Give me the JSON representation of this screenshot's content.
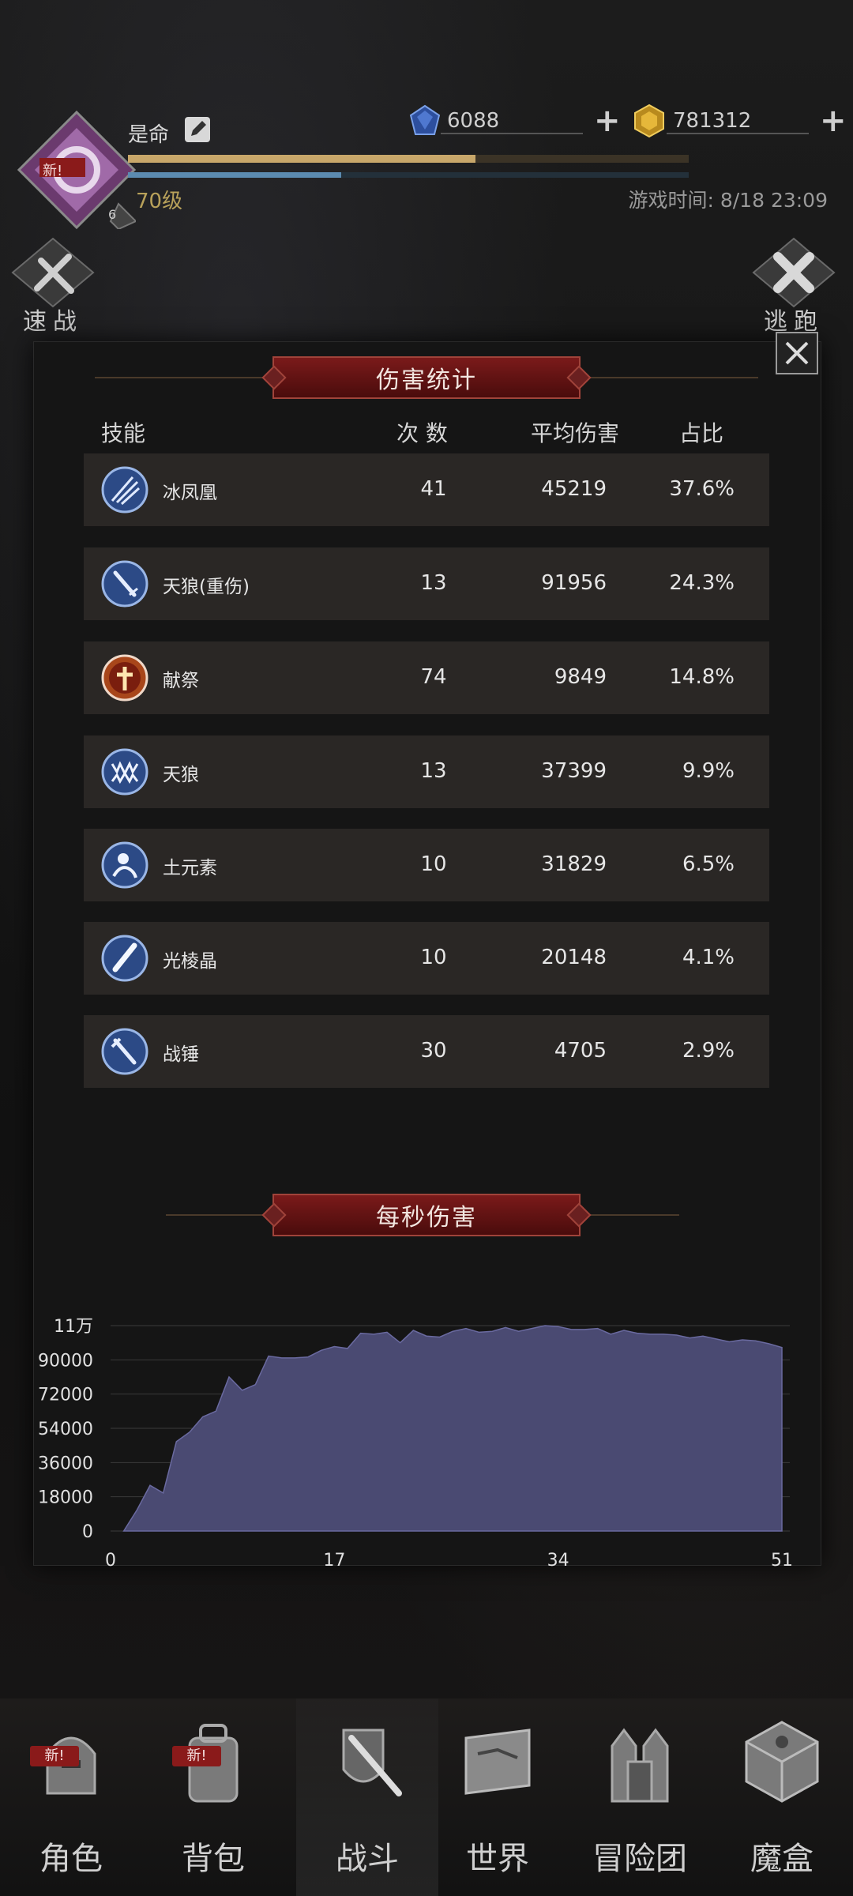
{
  "header": {
    "player_name": "是命",
    "avatar_badge": "新!",
    "level_small": "6",
    "level": "70级",
    "xp_fraction": 0.62,
    "hp_fraction": 0.38,
    "gems": "6088",
    "gold": "781312",
    "game_time": "游戏时间: 8/18 23:09",
    "quick_battle": "速战",
    "escape": "逃跑"
  },
  "damage_stats": {
    "title": "伤害统计",
    "columns": {
      "skill": "技能",
      "count": "次 数",
      "avg": "平均伤害",
      "share": "占比"
    },
    "rows": [
      {
        "icon": "ice-phoenix-icon",
        "name": "冰凤凰",
        "count": "41",
        "avg": "45219",
        "share": "37.6%"
      },
      {
        "icon": "sword-icon",
        "name": "天狼(重伤)",
        "count": "13",
        "avg": "91956",
        "share": "24.3%"
      },
      {
        "icon": "sacrifice-icon",
        "name": "献祭",
        "count": "74",
        "avg": "9849",
        "share": "14.8%"
      },
      {
        "icon": "wolf-fang-icon",
        "name": "天狼",
        "count": "13",
        "avg": "37399",
        "share": "9.9%"
      },
      {
        "icon": "earth-elemental-icon",
        "name": "土元素",
        "count": "10",
        "avg": "31829",
        "share": "6.5%"
      },
      {
        "icon": "crystal-blade-icon",
        "name": "光棱晶",
        "count": "10",
        "avg": "20148",
        "share": "4.1%"
      },
      {
        "icon": "warhammer-icon",
        "name": "战锤",
        "count": "30",
        "avg": "4705",
        "share": "2.9%"
      }
    ]
  },
  "dps": {
    "title": "每秒伤害"
  },
  "chart_data": {
    "type": "area",
    "title": "每秒伤害",
    "xlabel": "",
    "ylabel": "",
    "x_ticks": [
      "0",
      "17",
      "34",
      "51"
    ],
    "y_ticks": [
      "0",
      "18000",
      "36000",
      "54000",
      "72000",
      "90000",
      "11万"
    ],
    "xlim": [
      0,
      51
    ],
    "ylim": [
      0,
      108000
    ],
    "grid": true,
    "color": "#4a4a72",
    "x": [
      1,
      2,
      3,
      4,
      5,
      6,
      7,
      8,
      9,
      10,
      11,
      12,
      13,
      14,
      15,
      16,
      17,
      18,
      19,
      20,
      21,
      22,
      23,
      24,
      25,
      26,
      27,
      28,
      29,
      30,
      31,
      32,
      33,
      34,
      35,
      36,
      37,
      38,
      39,
      40,
      41,
      42,
      43,
      44,
      45,
      46,
      47,
      48,
      49,
      50,
      51
    ],
    "values": [
      0,
      11000,
      24000,
      20000,
      47000,
      52000,
      60000,
      63000,
      81000,
      74000,
      77000,
      92000,
      91000,
      91000,
      91500,
      95000,
      97000,
      96000,
      104000,
      103500,
      104500,
      99000,
      105500,
      102500,
      102000,
      105000,
      106500,
      104500,
      105000,
      107000,
      105000,
      106500,
      108000,
      107500,
      106000,
      106000,
      106500,
      103500,
      105500,
      104000,
      103500,
      103500,
      103000,
      101500,
      102500,
      101000,
      99500,
      100500,
      100000,
      98500,
      96500
    ]
  },
  "nav": {
    "items": [
      {
        "label": "角色",
        "badge": "新!"
      },
      {
        "label": "背包",
        "badge": "新!"
      },
      {
        "label": "战斗",
        "badge": ""
      },
      {
        "label": "世界",
        "badge": ""
      },
      {
        "label": "冒险团",
        "badge": ""
      },
      {
        "label": "魔盒",
        "badge": ""
      }
    ],
    "active_index": 2
  },
  "colors": {
    "banner": "#6a1414",
    "row_bg": "#2a2725",
    "xp": "#c8a76a",
    "hp": "#5c8bb0",
    "dps_fill": "#4a4a72",
    "level_text": "#b8a15a"
  }
}
